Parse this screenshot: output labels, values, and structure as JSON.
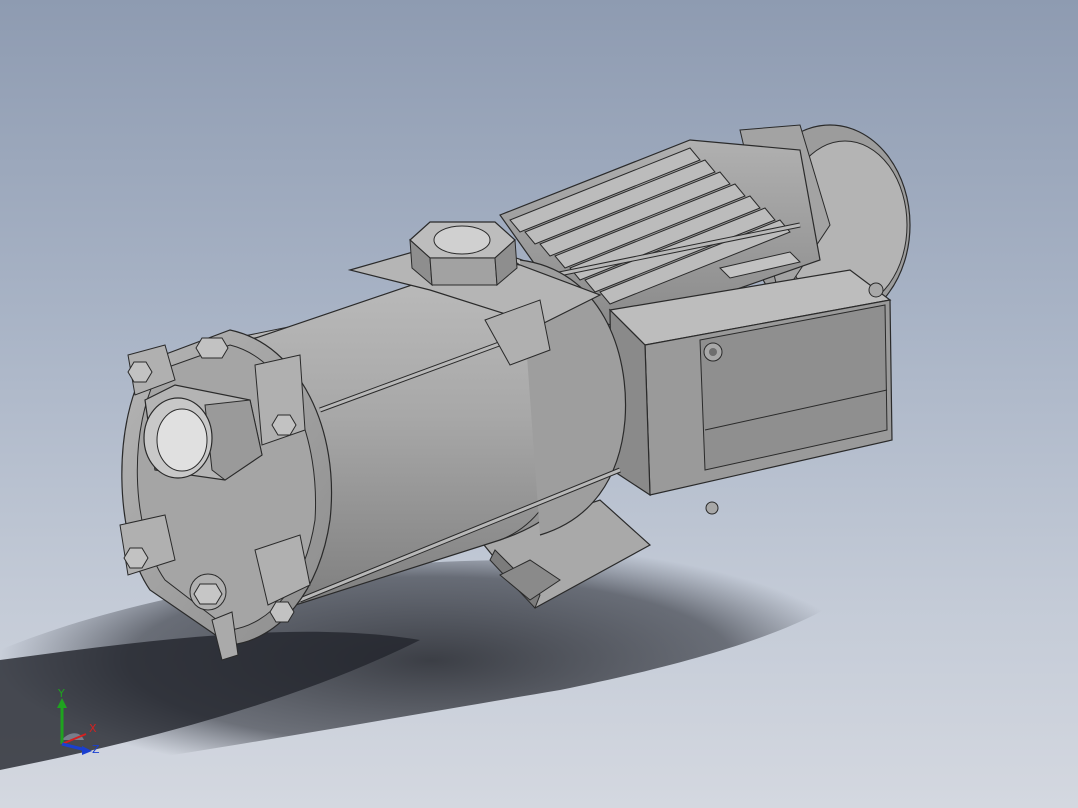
{
  "viewport": {
    "background_top": "#8e9bb1",
    "background_bottom": "#d4d8e0"
  },
  "model": {
    "body_color": "#a4a4a4",
    "edge_color": "#2a2a2a"
  },
  "triad": {
    "y_label": "Y",
    "x_label": "X",
    "z_label": "Z",
    "y_color": "#1fa31f",
    "x_color": "#d42020",
    "z_color": "#1a3fd0"
  }
}
